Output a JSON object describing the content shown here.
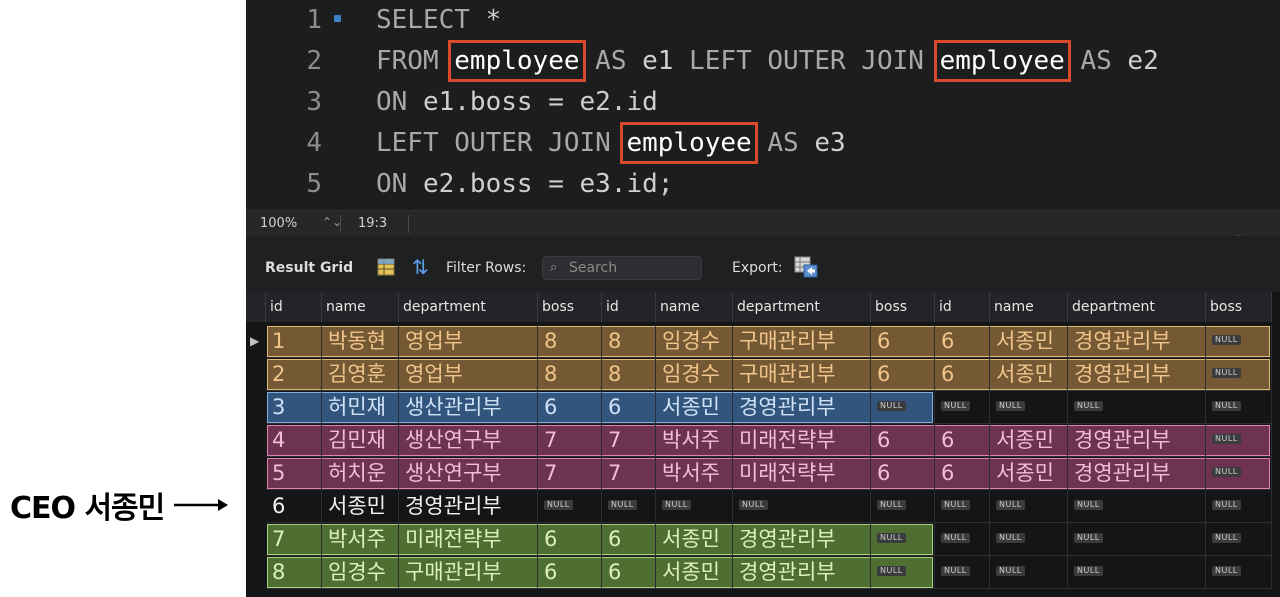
{
  "annotation": {
    "label": "CEO 서종민"
  },
  "editor": {
    "lines": [
      {
        "num": "1",
        "parts": [
          {
            "t": "kw",
            "v": "SELECT"
          },
          {
            "t": "p",
            "v": " *"
          }
        ]
      },
      {
        "num": "2",
        "parts": [
          {
            "t": "kw",
            "v": "FROM"
          },
          {
            "t": "sp",
            "v": " "
          },
          {
            "t": "tbl",
            "v": "employee"
          },
          {
            "t": "sp",
            "v": " "
          },
          {
            "t": "kw",
            "v": "AS"
          },
          {
            "t": "p",
            "v": " e1 "
          },
          {
            "t": "kw",
            "v": "LEFT OUTER JOIN"
          },
          {
            "t": "sp",
            "v": " "
          },
          {
            "t": "tbl",
            "v": "employee"
          },
          {
            "t": "sp",
            "v": " "
          },
          {
            "t": "kw",
            "v": "AS"
          },
          {
            "t": "p",
            "v": " e2"
          }
        ]
      },
      {
        "num": "3",
        "parts": [
          {
            "t": "kw",
            "v": "ON"
          },
          {
            "t": "p",
            "v": " e1.boss = e2.id"
          }
        ]
      },
      {
        "num": "4",
        "parts": [
          {
            "t": "kw",
            "v": "LEFT OUTER JOIN"
          },
          {
            "t": "sp",
            "v": " "
          },
          {
            "t": "tbl",
            "v": "employee"
          },
          {
            "t": "sp",
            "v": " "
          },
          {
            "t": "kw",
            "v": "AS"
          },
          {
            "t": "p",
            "v": " e3"
          }
        ]
      },
      {
        "num": "5",
        "parts": [
          {
            "t": "kw",
            "v": "ON"
          },
          {
            "t": "p",
            "v": " e2.boss = e3.id;"
          }
        ]
      }
    ]
  },
  "status": {
    "zoom": "100%",
    "position": "19:3"
  },
  "toolbar": {
    "result_grid": "Result Grid",
    "filter_rows": "Filter Rows:",
    "search_placeholder": "Search",
    "export": "Export:"
  },
  "grid": {
    "null_label": "NULL",
    "columns": [
      "id",
      "name",
      "department",
      "boss",
      "id",
      "name",
      "department",
      "boss",
      "id",
      "name",
      "department",
      "boss"
    ],
    "rows": [
      [
        "1",
        "박동현",
        "영업부",
        "8",
        "8",
        "임경수",
        "구매관리부",
        "6",
        "6",
        "서종민",
        "경영관리부",
        null
      ],
      [
        "2",
        "김영훈",
        "영업부",
        "8",
        "8",
        "임경수",
        "구매관리부",
        "6",
        "6",
        "서종민",
        "경영관리부",
        null
      ],
      [
        "3",
        "허민재",
        "생산관리부",
        "6",
        "6",
        "서종민",
        "경영관리부",
        null,
        null,
        null,
        null,
        null
      ],
      [
        "4",
        "김민재",
        "생산연구부",
        "7",
        "7",
        "박서주",
        "미래전략부",
        "6",
        "6",
        "서종민",
        "경영관리부",
        null
      ],
      [
        "5",
        "허치운",
        "생산연구부",
        "7",
        "7",
        "박서주",
        "미래전략부",
        "6",
        "6",
        "서종민",
        "경영관리부",
        null
      ],
      [
        "6",
        "서종민",
        "경영관리부",
        null,
        null,
        null,
        null,
        null,
        null,
        null,
        null,
        null
      ],
      [
        "7",
        "박서주",
        "미래전략부",
        "6",
        "6",
        "서종민",
        "경영관리부",
        null,
        null,
        null,
        null,
        null
      ],
      [
        "8",
        "임경수",
        "구매관리부",
        "6",
        "6",
        "서종민",
        "경영관리부",
        null,
        null,
        null,
        null,
        null
      ]
    ],
    "row_highlight": [
      "orange",
      "orange",
      "blue",
      "pink",
      "pink",
      "none",
      "green",
      "green"
    ],
    "highlight_colors": {
      "orange": "#c4914c",
      "blue": "#4278b4",
      "pink": "#aa4878",
      "green": "#68963e"
    }
  }
}
